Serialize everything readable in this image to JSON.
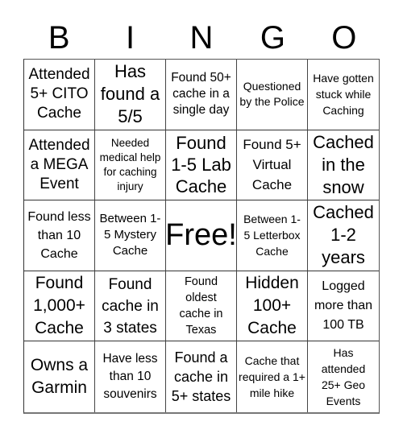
{
  "header": {
    "letters": [
      "B",
      "I",
      "N",
      "G",
      "O"
    ]
  },
  "board": {
    "cells": [
      [
        "Attended 5+ CITO Cache",
        "Has found a 5/5",
        "Found 50+ cache in a single day",
        "Questioned by the Police",
        "Have gotten stuck while Caching"
      ],
      [
        "Attended a MEGA Event",
        "Needed medical help for caching injury",
        "Found 1-5 Lab Cache",
        "Found 5+ Virtual Cache",
        "Cached in the snow"
      ],
      [
        "Found less than 10 Cache",
        "Between 1-5 Mystery Cache",
        "Free!",
        "Between 1-5 Letterbox Cache",
        "Cached 1-2 years"
      ],
      [
        "Found 1,000+ Cache",
        "Found cache in 3 states",
        "Found oldest cache in Texas",
        "Hidden 100+ Cache",
        "Logged more than 100 TB"
      ],
      [
        "Owns a Garmin",
        "Have less than 10 souvenirs",
        "Found a cache in 5+ states",
        "Cache that required a 1+ mile hike",
        "Has attended 25+ Geo Events"
      ]
    ]
  }
}
